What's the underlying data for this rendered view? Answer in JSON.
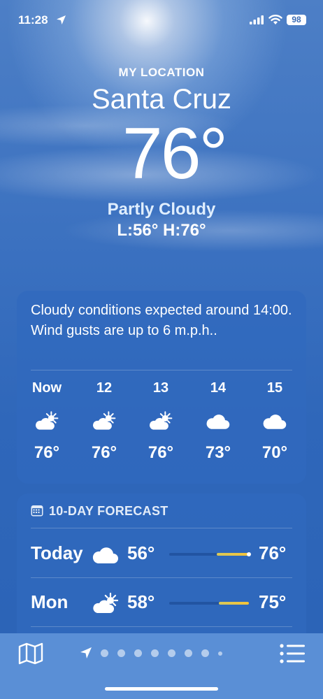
{
  "status_bar": {
    "time": "11:28",
    "battery": "98"
  },
  "header": {
    "location_label": "MY LOCATION",
    "city": "Santa Cruz",
    "temperature": "76°",
    "condition": "Partly Cloudy",
    "low_high": "L:56° H:76°"
  },
  "hourly": {
    "summary": "Cloudy conditions expected around 14:00. Wind gusts are up to 6 m.p.h..",
    "items": [
      {
        "time": "Now",
        "icon": "partly-sunny-icon",
        "temp": "76°"
      },
      {
        "time": "12",
        "icon": "partly-sunny-icon",
        "temp": "76°"
      },
      {
        "time": "13",
        "icon": "partly-sunny-icon",
        "temp": "76°"
      },
      {
        "time": "14",
        "icon": "cloud-icon",
        "temp": "73°"
      },
      {
        "time": "15",
        "icon": "cloud-icon",
        "temp": "70°"
      }
    ]
  },
  "forecast": {
    "title": "10-DAY FORECAST",
    "days": [
      {
        "day": "Today",
        "icon": "cloud-icon",
        "low": "56°",
        "high": "76°",
        "range_start": 0.6,
        "range_end": 1.0,
        "current_marker": 1.0
      },
      {
        "day": "Mon",
        "icon": "partly-sunny-icon",
        "low": "58°",
        "high": "75°",
        "range_start": 0.62,
        "range_end": 1.0
      }
    ]
  },
  "bottom_bar": {
    "page_count": 9,
    "active_page": 0
  },
  "colors": {
    "sky": "#3b71c0",
    "card": "#3069be",
    "bar_fill": "#f5c338"
  }
}
